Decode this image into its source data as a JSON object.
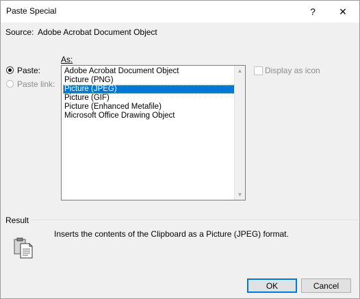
{
  "window": {
    "title": "Paste Special",
    "help_glyph": "?",
    "close_glyph": "✕"
  },
  "source": {
    "label": "Source:",
    "value": "Adobe Acrobat Document Object"
  },
  "paste_options": {
    "as_label": "As:",
    "paste_label": "Paste:",
    "paste_link_label": "Paste link:",
    "selected": "paste"
  },
  "as_list": {
    "items": [
      "Adobe Acrobat Document Object",
      "Picture (PNG)",
      "Picture (JPEG)",
      "Picture (GIF)",
      "Picture (Enhanced Metafile)",
      "Microsoft Office Drawing Object"
    ],
    "selected_index": 2
  },
  "display_as_icon": {
    "label": "Display as icon",
    "checked": false,
    "enabled": false
  },
  "result": {
    "heading": "Result",
    "text": "Inserts the contents of the Clipboard as a Picture (JPEG) format.",
    "icon": "clipboard-paste-icon"
  },
  "buttons": {
    "ok": "OK",
    "cancel": "Cancel"
  },
  "colors": {
    "selection": "#0078d7",
    "default_button_border": "#0078d7"
  }
}
